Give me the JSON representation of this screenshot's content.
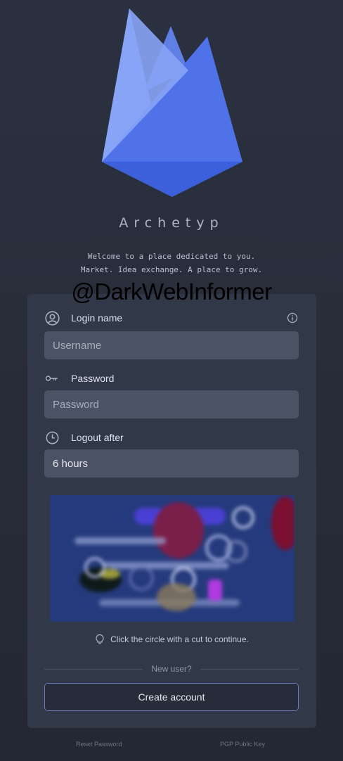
{
  "brand": {
    "name": "Archetyp"
  },
  "tagline": {
    "line1": "Welcome to a place dedicated to you.",
    "line2": "Market. Idea exchange. A place to grow."
  },
  "watermark": "@DarkWebInformer",
  "form": {
    "login_label": "Login name",
    "username_placeholder": "Username",
    "password_label": "Password",
    "password_placeholder": "Password",
    "logout_label": "Logout after",
    "logout_value": "6 hours",
    "captcha_hint": "Click the circle with a cut to continue.",
    "new_user_text": "New user?",
    "create_account_label": "Create account"
  },
  "footer": {
    "reset_password": "Reset Password",
    "pgp_key": "PGP Public Key"
  },
  "icons": {
    "login": "user-circle-icon",
    "info": "info-icon",
    "password": "key-icon",
    "logout": "clock-icon",
    "hint": "lightbulb-icon"
  },
  "colors": {
    "accent": "#4a6ee0",
    "button_border": "#6a7ab5"
  }
}
